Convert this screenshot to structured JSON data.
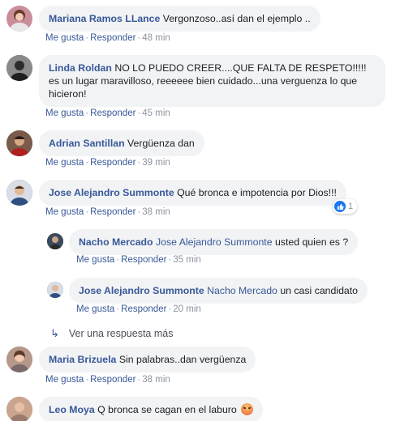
{
  "comments": [
    {
      "author": "Mariana Ramos LLance",
      "text": "Vergonzoso..así dan el ejemplo ..",
      "like": "Me gusta",
      "reply": "Responder",
      "time": "48 min",
      "avatar_color": "#c98e9a"
    },
    {
      "author": "Linda Roldan",
      "text": "NO LO PUEDO CREER....QUE FALTA DE RESPETO!!!!! es un lugar maravilloso, reeeeee bien cuidado...una verguenza lo que hicieron!",
      "like": "Me gusta",
      "reply": "Responder",
      "time": "45 min",
      "avatar_color": "#4a4a4a"
    },
    {
      "author": "Adrian Santillan",
      "text": "Vergüenza dan",
      "like": "Me gusta",
      "reply": "Responder",
      "time": "39 min",
      "avatar_color": "#6b4a3a"
    },
    {
      "author": "Jose Alejandro Summonte",
      "text": "Qué bronca e impotencia por Dios!!!",
      "like": "Me gusta",
      "reply": "Responder",
      "time": "38 min",
      "reaction_count": "1",
      "avatar_color": "#3d5a8a",
      "replies": [
        {
          "author": "Nacho Mercado",
          "mention": "Jose Alejandro Summonte",
          "text": "usted quien es ?",
          "like": "Me gusta",
          "reply": "Responder",
          "time": "35 min",
          "avatar_color": "#5b6b7a"
        },
        {
          "author": "Jose Alejandro Summonte",
          "mention": "Nacho Mercado",
          "text": "un casi candidato",
          "like": "Me gusta",
          "reply": "Responder",
          "time": "20 min",
          "avatar_color": "#3d5a8a"
        }
      ],
      "more_replies": "Ver una respuesta más"
    },
    {
      "author": "Maria Brizuela",
      "text": "Sin palabras..dan vergüenza",
      "like": "Me gusta",
      "reply": "Responder",
      "time": "38 min",
      "avatar_color": "#a07a68"
    },
    {
      "author": "Leo Moya",
      "text": "Q bronca se cagan en el laburo",
      "emoji": "angry-face-icon",
      "avatar_color": "#b08a78"
    }
  ],
  "colors": {
    "author": "#385898",
    "bubble": "#f2f3f5",
    "meta": "#8d949e",
    "like_blue": "#1877f2"
  }
}
